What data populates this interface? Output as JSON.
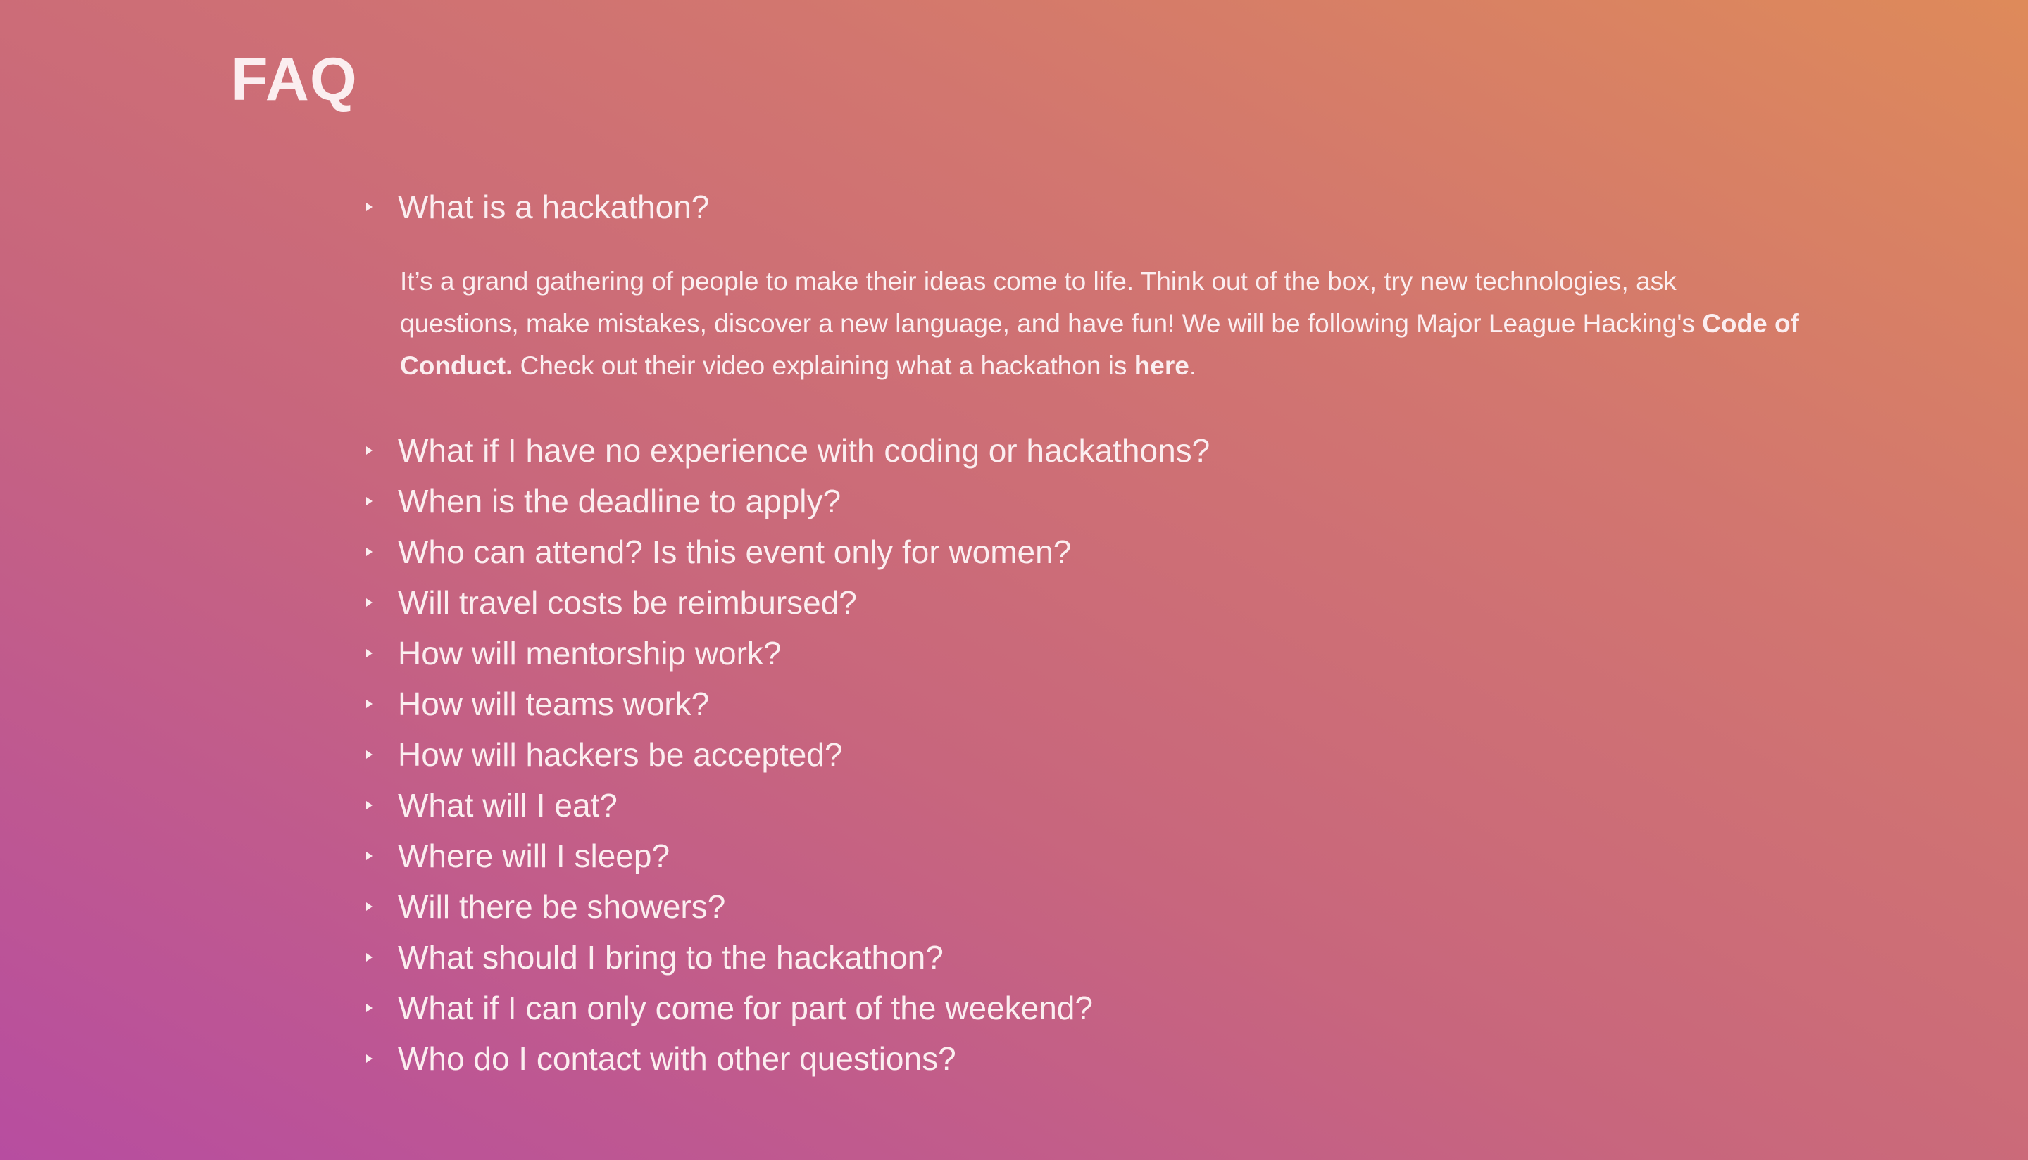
{
  "page": {
    "title": "FAQ"
  },
  "colors": {
    "gradient_top_right": "#de8a5a",
    "gradient_bottom_left": "#b74da0",
    "text": "#fbeef0"
  },
  "faq": {
    "open_item": {
      "question": "What is a hackathon?",
      "answer_part1": "It’s a grand gathering of people to make their ideas come to life. Think out of the box, try new technologies, ask questions, make mistakes, discover a new language, and have fun! We will be following Major League Hacking's ",
      "answer_link_code": "Code of Conduct.",
      "answer_part2": " Check out their video explaining what a hackathon is ",
      "answer_link_here": "here",
      "answer_part3": "."
    },
    "items": [
      "What if I have no experience with coding or hackathons?",
      "When is the deadline to apply?",
      "Who can attend? Is this event only for women?",
      "Will travel costs be reimbursed?",
      "How will mentorship work?",
      "How will teams work?",
      "How will hackers be accepted?",
      "What will I eat?",
      "Where will I sleep?",
      "Will there be showers?",
      "What should I bring to the hackathon?",
      "What if I can only come for part of the weekend?",
      "Who do I contact with other questions?"
    ],
    "marker_icon": "disclosure-triangle-right"
  }
}
